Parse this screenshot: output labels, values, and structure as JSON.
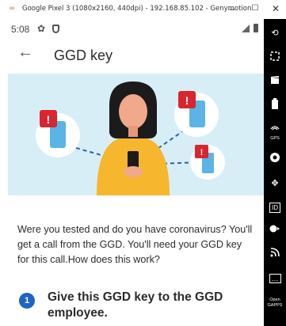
{
  "window": {
    "title": "Google Pixel 3 (1080x2160, 440dpi) - 192.168.85.102 - Genymotion",
    "logo_glyph": "∞",
    "minimize_glyph": "–",
    "maximize_glyph": "☐",
    "close_glyph": "✕"
  },
  "status_bar": {
    "time": "5:08",
    "gear_glyph": "✿"
  },
  "app_bar": {
    "back_glyph": "←",
    "title": "GGD key"
  },
  "content": {
    "intro": "Were you tested and do you have coronavirus? You'll get a call from the GGD. You'll need your GGD key for this call.How does this work?",
    "step": {
      "number": "1",
      "text": "Give this GGD key to the GGD employee."
    },
    "notification_glyph": "!"
  },
  "toolbar": {
    "rotate_glyph": "⟲",
    "gps_label": "GPS",
    "id_label": "ID",
    "nav_glyph": "✥",
    "menu_glyph": "…",
    "open_gapps_line1": "Open",
    "open_gapps_line2": "GAPPS"
  },
  "colors": {
    "accent": "#1e63c6",
    "hero_bg": "#d8eef7",
    "phone_blue": "#5ab4e6",
    "alert_red": "#d8262f",
    "shirt_yellow": "#f6b62d"
  }
}
